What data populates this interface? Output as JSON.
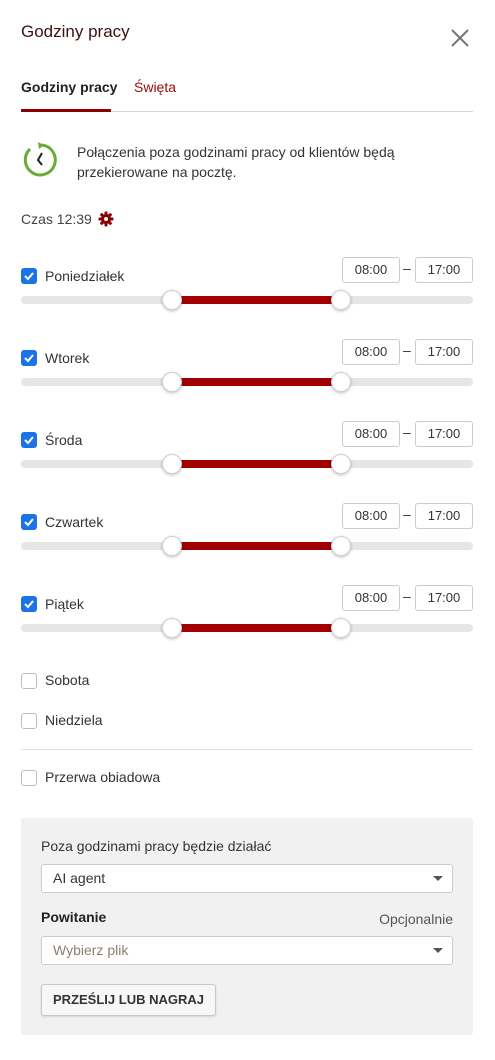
{
  "header": {
    "title": "Godziny pracy"
  },
  "tabs": [
    {
      "label": "Godziny pracy",
      "active": true
    },
    {
      "label": "Święta",
      "active": false
    }
  ],
  "info": {
    "text": "Połączenia poza godzinami pracy od klientów będą przekierowane na pocztę."
  },
  "clock": {
    "label": "Czas 12:39"
  },
  "days": [
    {
      "label": "Poniedziałek",
      "checked": true,
      "from": "08:00",
      "to": "17:00"
    },
    {
      "label": "Wtorek",
      "checked": true,
      "from": "08:00",
      "to": "17:00"
    },
    {
      "label": "Środa",
      "checked": true,
      "from": "08:00",
      "to": "17:00"
    },
    {
      "label": "Czwartek",
      "checked": true,
      "from": "08:00",
      "to": "17:00"
    },
    {
      "label": "Piątek",
      "checked": true,
      "from": "08:00",
      "to": "17:00"
    }
  ],
  "weekend": [
    {
      "label": "Sobota",
      "checked": false
    },
    {
      "label": "Niedziela",
      "checked": false
    }
  ],
  "lunch": {
    "label": "Przerwa obiadowa",
    "checked": false
  },
  "after_hours": {
    "title": "Poza godzinami pracy będzie działać",
    "selected": "AI agent",
    "greeting_label": "Powitanie",
    "optional_label": "Opcjonalnie",
    "file_placeholder": "Wybierz plik",
    "upload_button": "PRZEŚLIJ LUB NAGRAJ"
  },
  "colors": {
    "accent": "#a20000",
    "checkbox": "#1a73e8",
    "icon_green": "#6aab35"
  }
}
